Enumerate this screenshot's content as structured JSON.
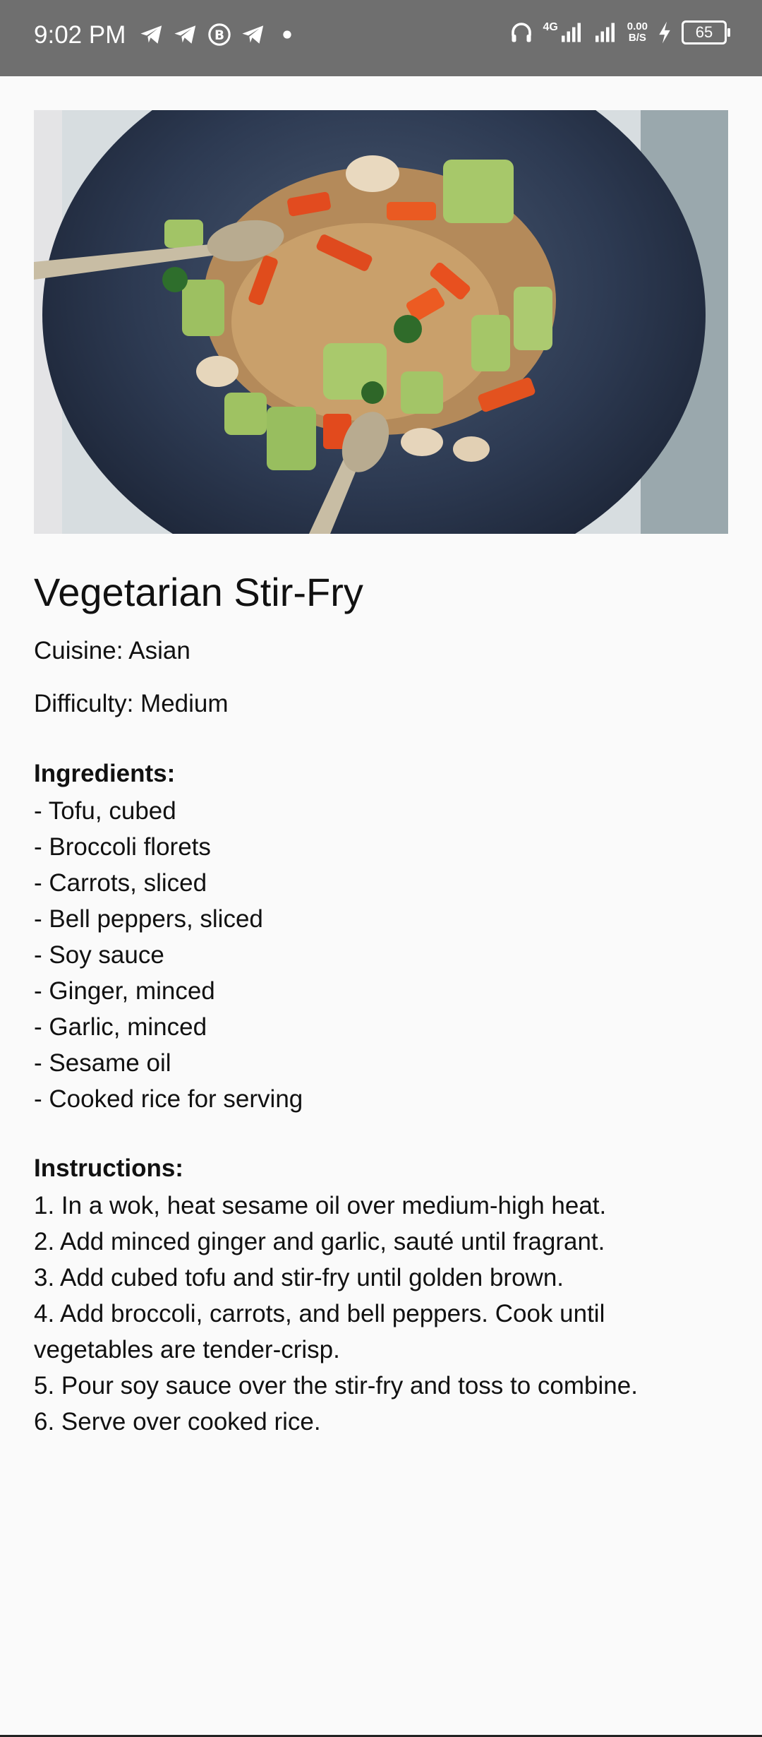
{
  "status_bar": {
    "time": "9:02 PM",
    "left_icons": [
      "telegram-icon",
      "telegram-icon",
      "b-circle-icon",
      "telegram-icon",
      "dot-icon"
    ],
    "network_label": "4G",
    "net_speed_value": "0.00",
    "net_speed_unit": "B/S",
    "battery_level": "65"
  },
  "recipe": {
    "title": "Vegetarian Stir-Fry",
    "cuisine": "Cuisine: Asian",
    "difficulty": "Difficulty: Medium",
    "ingredients_heading": "Ingredients:",
    "ingredients": [
      "- Tofu, cubed",
      "- Broccoli florets",
      "- Carrots, sliced",
      "- Bell peppers, sliced",
      "- Soy sauce",
      "- Ginger, minced",
      "- Garlic, minced",
      "- Sesame oil",
      "- Cooked rice for serving"
    ],
    "instructions_heading": "Instructions:",
    "instructions": [
      "1. In a wok, heat sesame oil over medium-high heat.",
      "2. Add minced ginger and garlic, sauté until fragrant.",
      "3. Add cubed tofu and stir-fry until golden brown.",
      "4. Add broccoli, carrots, and bell peppers. Cook until vegetables are tender-crisp.",
      "5. Pour soy sauce over the stir-fry and toss to combine.",
      "6. Serve over cooked rice."
    ]
  },
  "colors": {
    "status_bar_bg": "#6f6f6f",
    "page_bg": "#fafafa",
    "text": "#111111"
  }
}
